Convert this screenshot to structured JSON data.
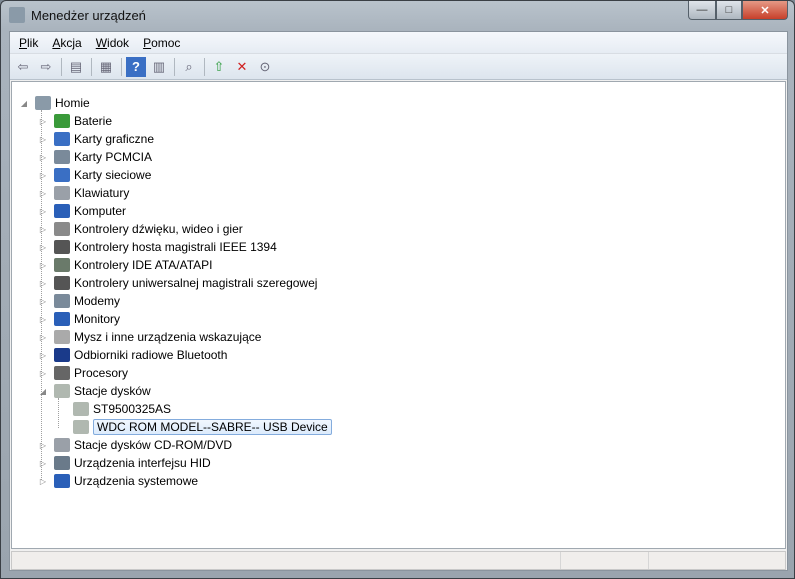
{
  "window": {
    "title": "Menedżer urządzeń",
    "minimize": "—",
    "maximize": "□",
    "close": "✕"
  },
  "menu": [
    "Plik",
    "Akcja",
    "Widok",
    "Pomoc"
  ],
  "toolbar": [
    {
      "name": "back-icon",
      "glyph": "⇦"
    },
    {
      "name": "forward-icon",
      "glyph": "⇨"
    },
    "sep",
    {
      "name": "show-hide-console-tree-icon",
      "glyph": "▤"
    },
    "sep",
    {
      "name": "properties-icon",
      "glyph": "▦"
    },
    "sep",
    {
      "name": "help-icon",
      "glyph": "?"
    },
    {
      "name": "show-action-pane-icon",
      "glyph": "▥"
    },
    "sep",
    {
      "name": "scan-hardware-icon",
      "glyph": "⌕"
    },
    "sep",
    {
      "name": "update-driver-icon",
      "glyph": "⇧"
    },
    {
      "name": "uninstall-icon",
      "glyph": "✕"
    },
    {
      "name": "disable-icon",
      "glyph": "⊙"
    }
  ],
  "tree": {
    "root": "Homie",
    "items": [
      {
        "label": "Baterie",
        "color": "#3a9a3a"
      },
      {
        "label": "Karty graficzne",
        "color": "#3a6fc4"
      },
      {
        "label": "Karty PCMCIA",
        "color": "#7a8a9a"
      },
      {
        "label": "Karty sieciowe",
        "color": "#3a6fc4"
      },
      {
        "label": "Klawiatury",
        "color": "#9aa0a8"
      },
      {
        "label": "Komputer",
        "color": "#2a5fb8"
      },
      {
        "label": "Kontrolery dźwięku, wideo i gier",
        "color": "#8a8a8a"
      },
      {
        "label": "Kontrolery hosta magistrali IEEE 1394",
        "color": "#555"
      },
      {
        "label": "Kontrolery IDE ATA/ATAPI",
        "color": "#6a7a6a"
      },
      {
        "label": "Kontrolery uniwersalnej magistrali szeregowej",
        "color": "#555"
      },
      {
        "label": "Modemy",
        "color": "#7a8a9a"
      },
      {
        "label": "Monitory",
        "color": "#2a5fb8"
      },
      {
        "label": "Mysz i inne urządzenia wskazujące",
        "color": "#aaa"
      },
      {
        "label": "Odbiorniki radiowe Bluetooth",
        "color": "#1a3a8a"
      },
      {
        "label": "Procesory",
        "color": "#666"
      },
      {
        "label": "Stacje dysków",
        "color": "#b0b8b0",
        "expanded": true,
        "children": [
          {
            "label": "ST9500325AS"
          },
          {
            "label": "WDC ROM MODEL--SABRE-- USB Device",
            "selected": true
          }
        ]
      },
      {
        "label": "Stacje dysków CD-ROM/DVD",
        "color": "#9aa0a8"
      },
      {
        "label": "Urządzenia interfejsu HID",
        "color": "#6a7a8a"
      },
      {
        "label": "Urządzenia systemowe",
        "color": "#2a5fb8"
      }
    ]
  }
}
